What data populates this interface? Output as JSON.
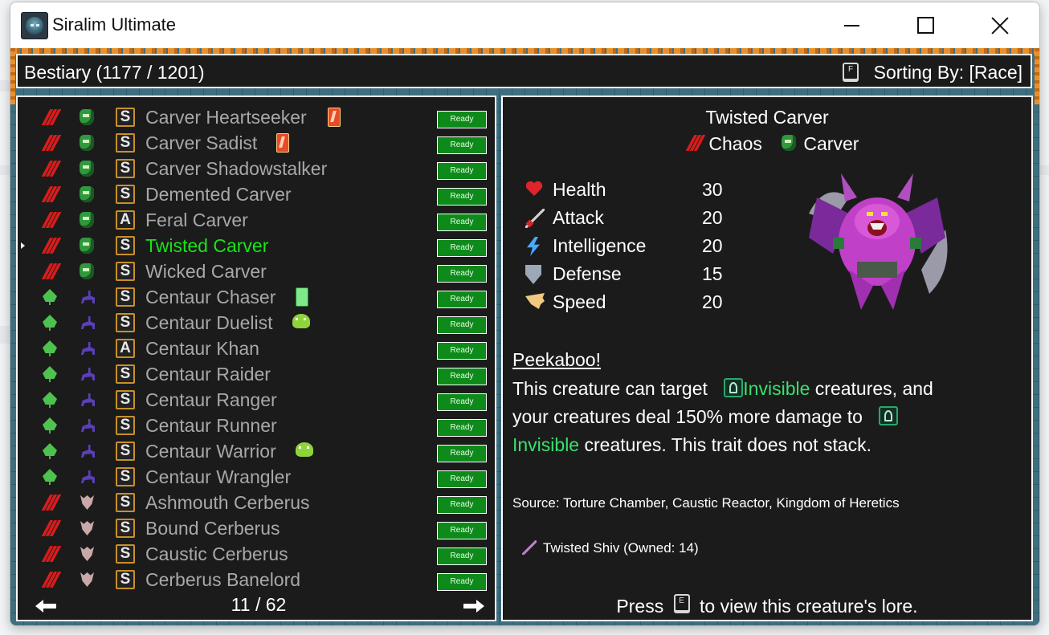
{
  "window": {
    "title": "Siralim Ultimate"
  },
  "header": {
    "title": "Bestiary (1177 / 1201)",
    "sort_key": "F",
    "sort_label": "Sorting By: [Race]"
  },
  "list": {
    "ready_label": "Ready",
    "page": "11 / 62",
    "rows": [
      {
        "name": "Carver Heartseeker",
        "element": "chaos",
        "race": "carver",
        "class": "S",
        "badge": "card"
      },
      {
        "name": "Carver Sadist",
        "element": "chaos",
        "race": "carver",
        "class": "S",
        "badge": "card"
      },
      {
        "name": "Carver Shadowstalker",
        "element": "chaos",
        "race": "carver",
        "class": "S",
        "badge": ""
      },
      {
        "name": "Demented Carver",
        "element": "chaos",
        "race": "carver",
        "class": "S",
        "badge": ""
      },
      {
        "name": "Feral Carver",
        "element": "chaos",
        "race": "carver",
        "class": "A",
        "badge": ""
      },
      {
        "name": "Twisted Carver",
        "element": "chaos",
        "race": "carver",
        "class": "S",
        "badge": "",
        "selected": true
      },
      {
        "name": "Wicked Carver",
        "element": "chaos",
        "race": "carver",
        "class": "S",
        "badge": ""
      },
      {
        "name": "Centaur Chaser",
        "element": "nature",
        "race": "centaur",
        "class": "S",
        "badge": "potion"
      },
      {
        "name": "Centaur Duelist",
        "element": "nature",
        "race": "centaur",
        "class": "S",
        "badge": "slime"
      },
      {
        "name": "Centaur Khan",
        "element": "nature",
        "race": "centaur",
        "class": "A",
        "badge": ""
      },
      {
        "name": "Centaur Raider",
        "element": "nature",
        "race": "centaur",
        "class": "S",
        "badge": ""
      },
      {
        "name": "Centaur Ranger",
        "element": "nature",
        "race": "centaur",
        "class": "S",
        "badge": ""
      },
      {
        "name": "Centaur Runner",
        "element": "nature",
        "race": "centaur",
        "class": "S",
        "badge": ""
      },
      {
        "name": "Centaur Warrior",
        "element": "nature",
        "race": "centaur",
        "class": "S",
        "badge": "slime"
      },
      {
        "name": "Centaur Wrangler",
        "element": "nature",
        "race": "centaur",
        "class": "S",
        "badge": ""
      },
      {
        "name": "Ashmouth Cerberus",
        "element": "chaos",
        "race": "cerberus",
        "class": "S",
        "badge": ""
      },
      {
        "name": "Bound Cerberus",
        "element": "chaos",
        "race": "cerberus",
        "class": "S",
        "badge": ""
      },
      {
        "name": "Caustic Cerberus",
        "element": "chaos",
        "race": "cerberus",
        "class": "S",
        "badge": ""
      },
      {
        "name": "Cerberus Banelord",
        "element": "chaos",
        "race": "cerberus",
        "class": "S",
        "badge": ""
      }
    ]
  },
  "detail": {
    "name": "Twisted Carver",
    "element": "Chaos",
    "race": "Carver",
    "stats": [
      {
        "label": "Health",
        "value": "30",
        "icon": "heart-icon"
      },
      {
        "label": "Attack",
        "value": "20",
        "icon": "sword-icon"
      },
      {
        "label": "Intelligence",
        "value": "20",
        "icon": "lightning-icon"
      },
      {
        "label": "Defense",
        "value": "15",
        "icon": "shield-icon"
      },
      {
        "label": "Speed",
        "value": "20",
        "icon": "wing-icon"
      }
    ],
    "trait": {
      "name": "Peekaboo!",
      "part1": "This creature can target",
      "keyword": "Invisible",
      "part2": "creatures, and your creatures deal 150% more damage to",
      "part3": "creatures. This trait does not stack."
    },
    "source": "Source: Torture Chamber, Caustic Reactor, Kingdom of Heretics",
    "material": "Twisted Shiv (Owned: 14)",
    "lore": {
      "prefix": "Press",
      "key": "E",
      "suffix": "to view this creature's lore."
    }
  },
  "colors": {
    "selected": "#19e319",
    "ready_bg": "#0e8a1a",
    "keyword": "#3ae070",
    "panel_bg": "#1b1b1b"
  }
}
